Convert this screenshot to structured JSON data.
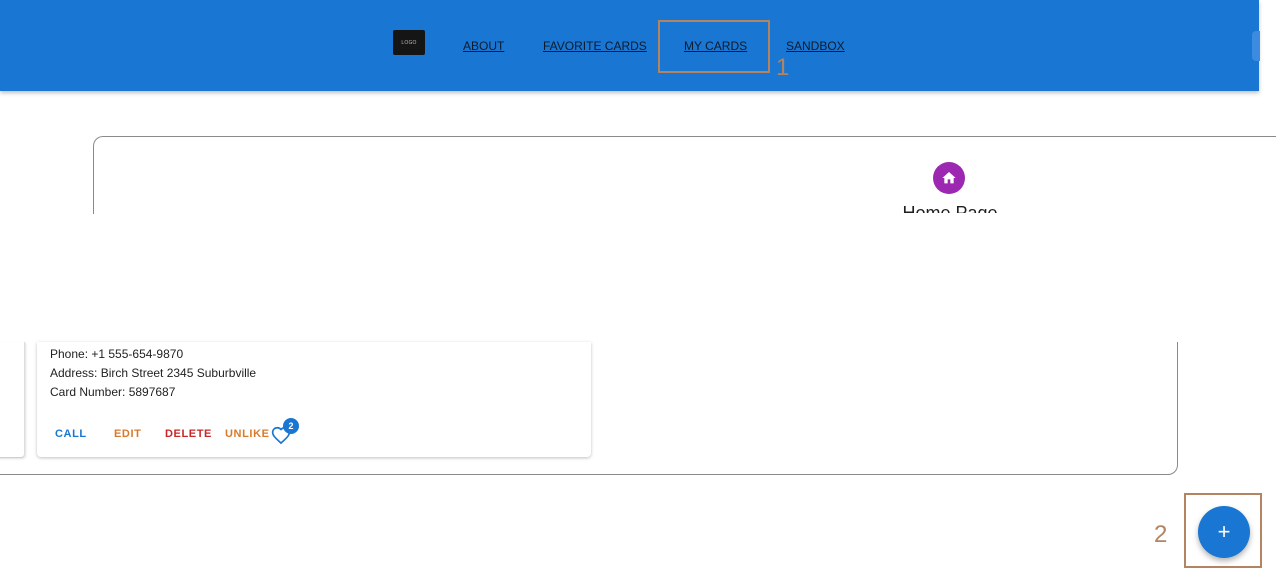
{
  "header": {
    "logo_text": "LOGO",
    "nav": [
      {
        "label": "ABOUT"
      },
      {
        "label": "FAVORITE CARDS"
      },
      {
        "label": "MY CARDS"
      },
      {
        "label": "SANDBOX"
      }
    ]
  },
  "annotations": [
    "1",
    "2"
  ],
  "hero": {
    "title": "Home Page",
    "icon": "home-icon"
  },
  "card": {
    "phone": "Phone: +1 555-654-9870",
    "address": "Address: Birch Street 2345 Suburbville",
    "card_number": "Card Number: 5897687",
    "actions": {
      "call": "CALL",
      "edit": "EDIT",
      "delete": "DELETE",
      "unlike": "UNLIKE"
    },
    "like_count": "2"
  },
  "fab": {
    "label": "+",
    "icon": "plus-icon"
  },
  "colors": {
    "primary": "#1976d2",
    "accent_purple": "#9c27b0",
    "edit_orange": "#d97a2b",
    "delete_red": "#c62828",
    "annotation": "#b28461"
  }
}
